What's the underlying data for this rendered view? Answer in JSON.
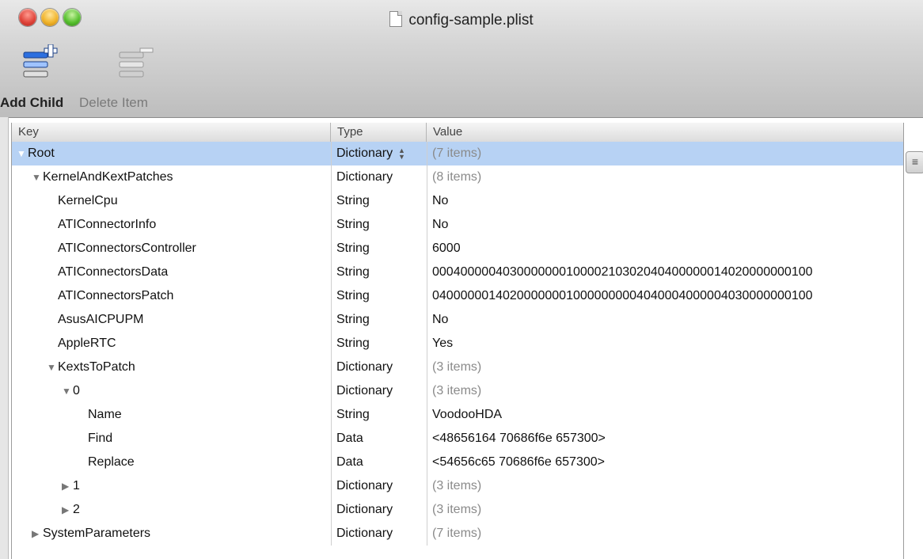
{
  "window": {
    "title": "config-sample.plist"
  },
  "toolbar": {
    "add_child_label": "Add Child",
    "delete_item_label": "Delete Item"
  },
  "table": {
    "headers": {
      "key": "Key",
      "type": "Type",
      "value": "Value"
    },
    "rows": [
      {
        "key": "Root",
        "type": "Dictionary",
        "value": "(7 items)",
        "depth": 0,
        "disclosure": "open",
        "muted": true,
        "selected": true
      },
      {
        "key": "KernelAndKextPatches",
        "type": "Dictionary",
        "value": "(8 items)",
        "depth": 1,
        "disclosure": "open",
        "muted": true
      },
      {
        "key": "KernelCpu",
        "type": "String",
        "value": "No",
        "depth": 2,
        "disclosure": "none"
      },
      {
        "key": "ATIConnectorInfo",
        "type": "String",
        "value": "No",
        "depth": 2,
        "disclosure": "none"
      },
      {
        "key": "ATIConnectorsController",
        "type": "String",
        "value": "6000",
        "depth": 2,
        "disclosure": "none"
      },
      {
        "key": "ATIConnectorsData",
        "type": "String",
        "value": "000400000403000000010000210302040400000014020000000100",
        "depth": 2,
        "disclosure": "none"
      },
      {
        "key": "ATIConnectorsPatch",
        "type": "String",
        "value": "040000001402000000010000000004040004000004030000000100",
        "depth": 2,
        "disclosure": "none"
      },
      {
        "key": "AsusAICPUPM",
        "type": "String",
        "value": "No",
        "depth": 2,
        "disclosure": "none"
      },
      {
        "key": "AppleRTC",
        "type": "String",
        "value": "Yes",
        "depth": 2,
        "disclosure": "none"
      },
      {
        "key": "KextsToPatch",
        "type": "Dictionary",
        "value": "(3 items)",
        "depth": 2,
        "disclosure": "open",
        "muted": true
      },
      {
        "key": "0",
        "type": "Dictionary",
        "value": "(3 items)",
        "depth": 3,
        "disclosure": "open",
        "muted": true
      },
      {
        "key": "Name",
        "type": "String",
        "value": "VoodooHDA",
        "depth": 4,
        "disclosure": "none"
      },
      {
        "key": "Find",
        "type": "Data",
        "value": "<48656164 70686f6e 657300>",
        "depth": 4,
        "disclosure": "none"
      },
      {
        "key": "Replace",
        "type": "Data",
        "value": "<54656c65 70686f6e 657300>",
        "depth": 4,
        "disclosure": "none"
      },
      {
        "key": "1",
        "type": "Dictionary",
        "value": "(3 items)",
        "depth": 3,
        "disclosure": "closed",
        "muted": true
      },
      {
        "key": "2",
        "type": "Dictionary",
        "value": "(3 items)",
        "depth": 3,
        "disclosure": "closed",
        "muted": true
      },
      {
        "key": "SystemParameters",
        "type": "Dictionary",
        "value": "(7 items)",
        "depth": 1,
        "disclosure": "closed",
        "muted": true
      }
    ]
  },
  "icons": {
    "add_child": "add-child-icon",
    "delete_item": "delete-item-icon",
    "document": "document-icon"
  }
}
